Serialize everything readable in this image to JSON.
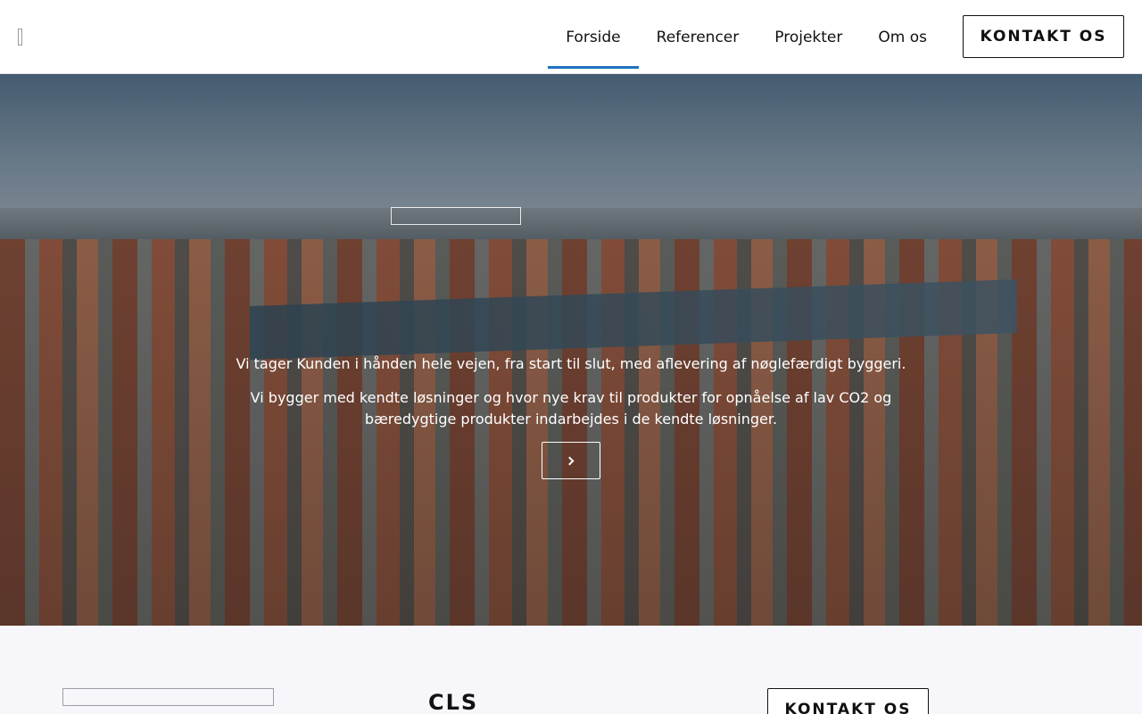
{
  "header": {
    "nav": [
      {
        "label": "Forside",
        "active": true
      },
      {
        "label": "Referencer",
        "active": false
      },
      {
        "label": "Projekter",
        "active": false
      },
      {
        "label": "Om os",
        "active": false
      }
    ],
    "cta_label": "KONTAKT OS"
  },
  "hero": {
    "line1": "Vi tager Kunden i hånden hele vejen, fra start til slut, med aflevering af nøglefærdigt byggeri.",
    "line2": "Vi bygger med kendte løsninger og hvor nye krav til produkter for opnåelse af lav CO2 og bæredygtige produkter indarbejdes i de kendte løsninger.",
    "arrow_icon": "chevron-right-icon"
  },
  "section": {
    "title": "CLS",
    "cta_label": "KONTAKT OS"
  },
  "colors": {
    "accent": "#1e73be",
    "text": "#111111",
    "section_bg": "#f7f7fb"
  }
}
